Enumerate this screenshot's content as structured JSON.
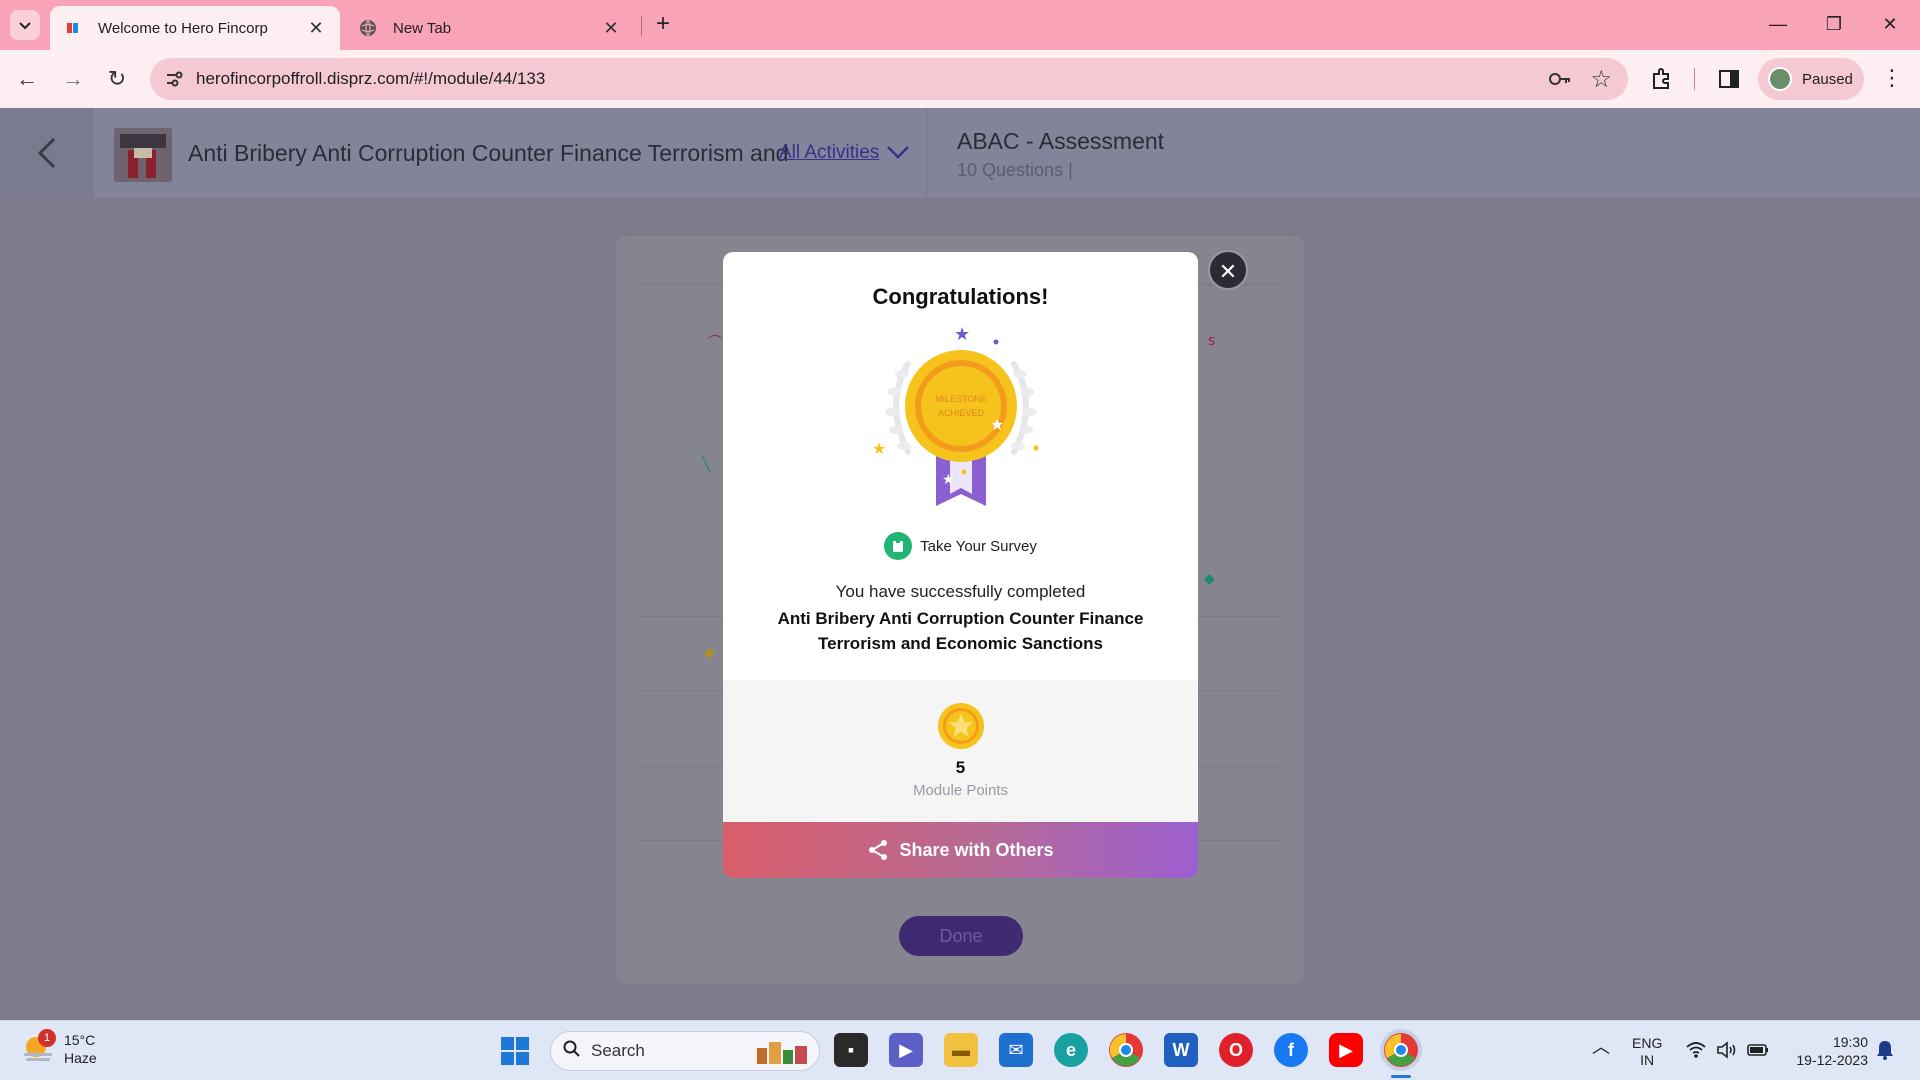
{
  "browser": {
    "tabs": [
      {
        "title": "Welcome to Hero Fincorp",
        "active": true
      },
      {
        "title": "New Tab",
        "active": false
      }
    ],
    "url": "herofincorpoffroll.disprz.com/#!/module/44/133",
    "profile_label": "Paused"
  },
  "header": {
    "module_title": "Anti Bribery Anti Corruption Counter Finance Terrorism and",
    "all_activities": "All Activities",
    "assessment_title": "ABAC - Assessment",
    "assessment_sub": "10 Questions |"
  },
  "card": {
    "done_label": "Done"
  },
  "modal": {
    "title": "Congratulations!",
    "medal_text_line1": "MILESTONE",
    "medal_text_line2": "ACHIEVED",
    "survey_label": "Take Your Survey",
    "message": "You have successfully completed",
    "course_name": "Anti Bribery Anti Corruption Counter Finance Terrorism and Economic Sanctions",
    "points_value": "5",
    "points_label": "Module Points",
    "share_label": "Share with Others"
  },
  "taskbar": {
    "weather_temp": "15°C",
    "weather_desc": "Haze",
    "weather_badge": "1",
    "search_placeholder": "Search",
    "lang_line1": "ENG",
    "lang_line2": "IN",
    "time": "19:30",
    "date": "19-12-2023"
  },
  "colors": {
    "tabbar": "#f9a3b8",
    "accent_purple": "#3b2f8a",
    "share_gradient_start": "#d95d6a",
    "share_gradient_end": "#9c5fd0",
    "medal_gold": "#f6c21c",
    "ribbon_purple": "#8a5fd0"
  }
}
